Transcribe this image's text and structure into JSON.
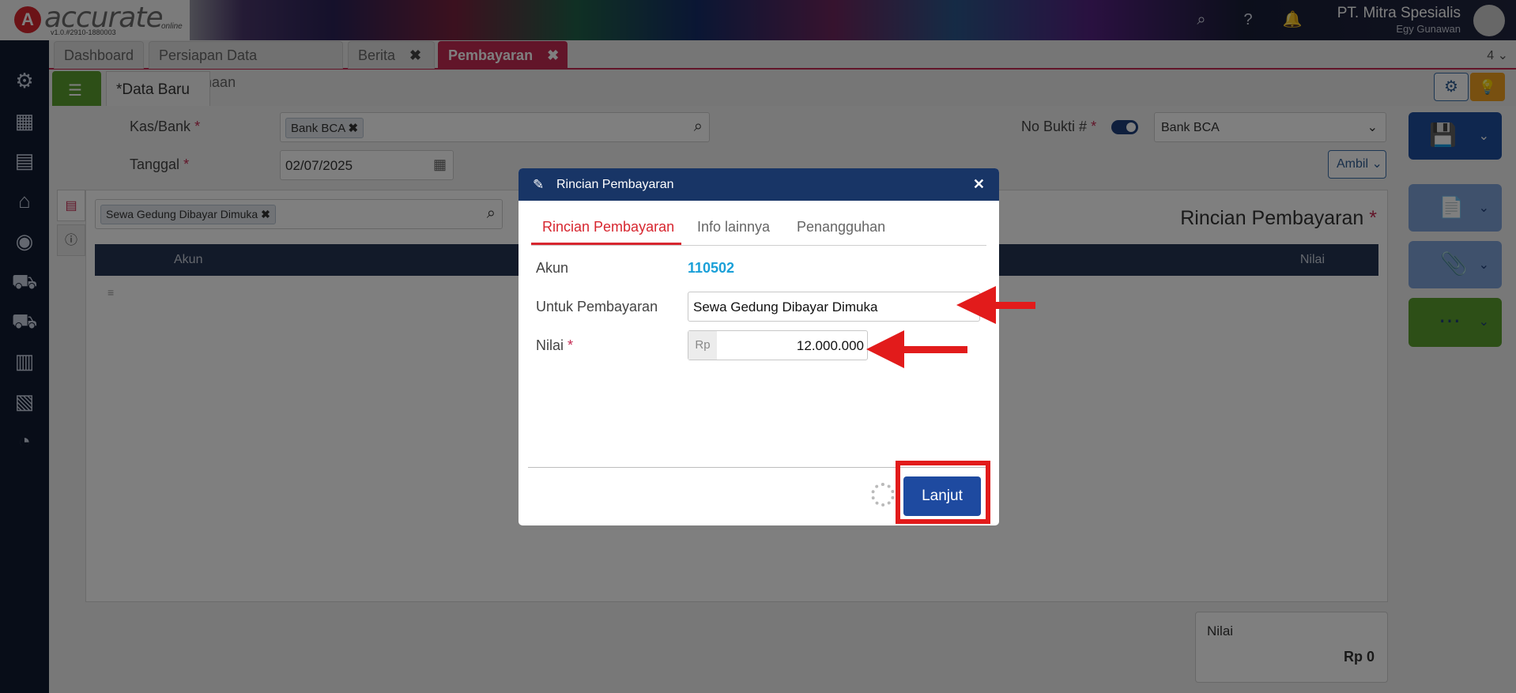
{
  "app": {
    "logo_letter": "A",
    "logo_text": "accurate",
    "logo_sub": "online",
    "version": "v1.0.#2910-1880003",
    "company": "PT. Mitra Spesialis",
    "user": "Egy Gunawan"
  },
  "tabs": [
    {
      "label": "Dashboard"
    },
    {
      "label": "Persiapan Data Perusahaan"
    },
    {
      "label": "Berita",
      "close": "✖"
    },
    {
      "label": "Pembayaran",
      "close": "✖",
      "active": true
    }
  ],
  "tab_count": "4",
  "subtab": {
    "label": "*Data Baru",
    "close": "✖"
  },
  "form": {
    "kasbank_label": "Kas/Bank",
    "kasbank_value": "Bank BCA",
    "tanggal_label": "Tanggal",
    "tanggal_value": "02/07/2025",
    "nobukti_label": "No Bukti #",
    "nobukti_value": "Bank BCA",
    "ambil_label": "Ambil",
    "required_mark": "*"
  },
  "detail": {
    "search_chip": "Sewa Gedung Dibayar Dimuka",
    "title": "Rincian Pembayaran",
    "col_akun": "Akun",
    "col_nilai": "Nilai",
    "total_label": "Nilai",
    "total_value": "Rp 0"
  },
  "modal": {
    "title": "Rincian Pembayaran",
    "tabs": [
      "Rincian Pembayaran",
      "Info lainnya",
      "Penangguhan"
    ],
    "akun_label": "Akun",
    "akun_value": "110502",
    "untuk_label": "Untuk Pembayaran",
    "untuk_value": "Sewa Gedung Dibayar Dimuka",
    "nilai_label": "Nilai",
    "nilai_prefix": "Rp",
    "nilai_value": "12.000.000",
    "lanjut_label": "Lanjut"
  },
  "colors": {
    "accent_tab": "#c42a52",
    "modal_header": "#183566",
    "primary_button": "#1e4aa0",
    "annotation_red": "#e21b1b"
  }
}
